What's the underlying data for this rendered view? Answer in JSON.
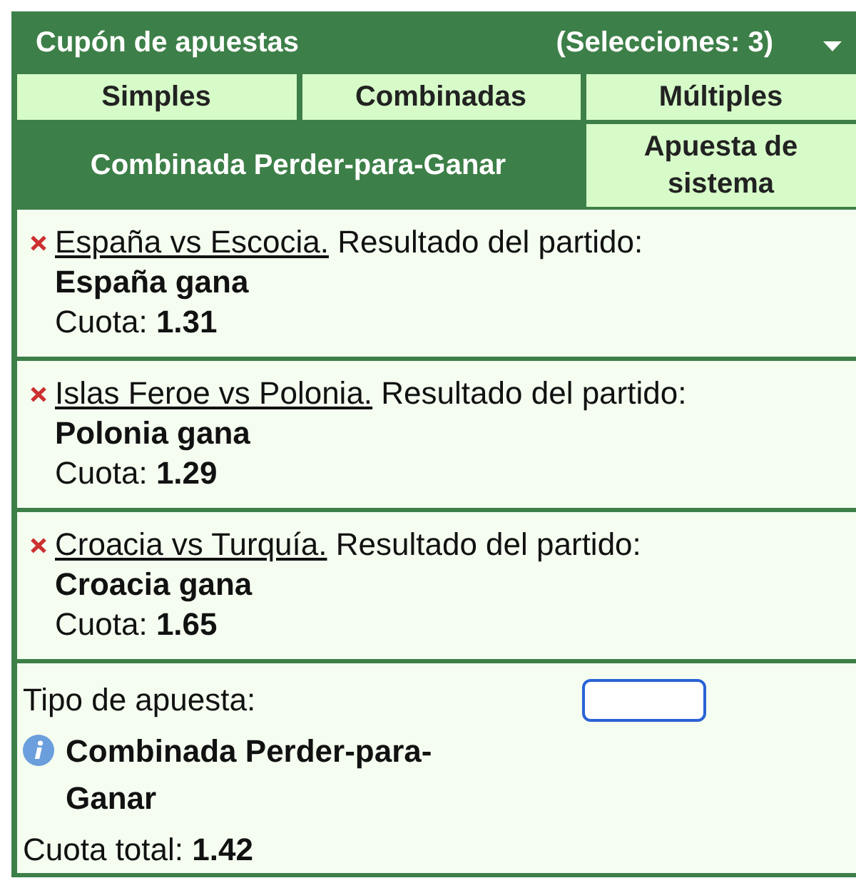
{
  "header": {
    "title": "Cupón de apuestas",
    "selections": "(Selecciones: 3)"
  },
  "tab_rows": [
    [
      {
        "label": "Simples",
        "selected": false
      },
      {
        "label": "Combinadas",
        "selected": false
      },
      {
        "label": "Múltiples",
        "selected": false
      }
    ],
    [
      {
        "label": "Combinada Perder-para-Ganar",
        "selected": true
      },
      {
        "label": "Apuesta de sistema",
        "selected": false
      }
    ]
  ],
  "selections": [
    {
      "match": "España vs Escocia.",
      "market": "Resultado del partido:",
      "outcome": "España gana",
      "odds": "Cuota: **1.31**"
    },
    {
      "match": "Islas Feroe vs Polonia.",
      "market": "Resultado del partido:",
      "outcome": "Polonia gana",
      "odds": "Cuota: **1.29**"
    },
    {
      "match": "Croacia vs Turquía.",
      "market": "Resultado del partido:",
      "outcome": "Croacia gana",
      "odds": "Cuota: **1.65**"
    }
  ],
  "summary": {
    "bet_type_label": "Tipo de apuesta:",
    "stake_field": {
      "focused": true
    },
    "bet_type": "Combinada Perder-para-Ganar",
    "total_odds": "Cuota total: **1.42**"
  }
}
